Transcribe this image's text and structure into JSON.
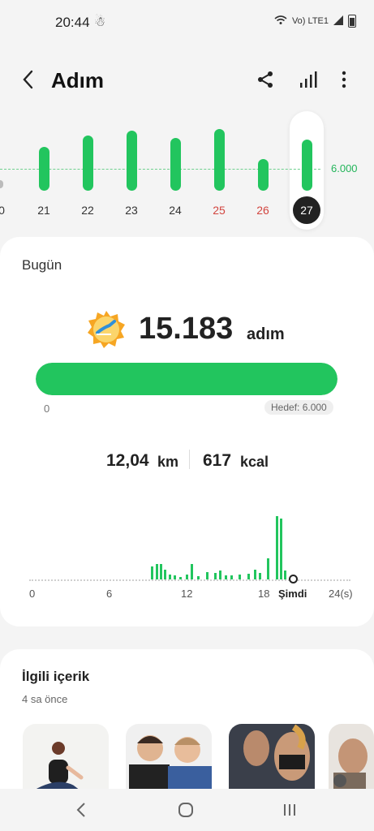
{
  "status_bar": {
    "time": "20:44",
    "network": "Vo) LTE1",
    "icons": [
      "person-icon",
      "wifi-icon",
      "signal-icon",
      "battery-icon"
    ]
  },
  "header": {
    "title": "Adım",
    "actions": [
      "share-icon",
      "stats-icon",
      "more-icon"
    ]
  },
  "week_chart": {
    "goal_label": "6.000",
    "days": [
      {
        "label": "0",
        "value": 0
      },
      {
        "label": "21",
        "value": 0.69
      },
      {
        "label": "22",
        "value": 0.87
      },
      {
        "label": "23",
        "value": 0.95
      },
      {
        "label": "24",
        "value": 0.83
      },
      {
        "label": "25",
        "value": 0.97,
        "weekend": true
      },
      {
        "label": "26",
        "value": 0.5,
        "weekend": true
      },
      {
        "label": "27",
        "value": 0.81,
        "selected": true
      }
    ],
    "colors": {
      "bar": "#22c55e",
      "weekend": "#d2453f"
    }
  },
  "today": {
    "label": "Bugün",
    "steps_value": "15.183",
    "steps_unit": "adım",
    "progress_fraction": 1.0,
    "progress_start": "0",
    "goal": "Hedef: 6.000",
    "distance_value": "12,04",
    "distance_unit": "km",
    "energy_value": "617",
    "energy_unit": "kcal"
  },
  "hourly_chart": {
    "ticks": [
      "0",
      "6",
      "12",
      "18",
      "Şimdi",
      "24(s)"
    ],
    "hours": [
      9.3,
      9.7,
      10.0,
      10.3,
      10.7,
      11.1,
      11.5,
      12.0,
      12.4,
      12.9,
      13.6,
      14.2,
      14.6,
      15.0,
      15.5,
      16.1,
      16.8,
      17.3,
      17.7,
      18.3,
      19.0,
      19.3,
      19.6
    ],
    "values": [
      0.2,
      0.25,
      0.25,
      0.15,
      0.08,
      0.06,
      0.04,
      0.08,
      0.25,
      0.05,
      0.12,
      0.1,
      0.14,
      0.06,
      0.07,
      0.08,
      0.09,
      0.16,
      0.1,
      0.33,
      1.0,
      0.96,
      0.14
    ]
  },
  "related": {
    "title": "İlgili içerik",
    "time": "4 sa önce",
    "thumbnails": [
      "workout-thumbnail-1",
      "workout-thumbnail-2",
      "workout-thumbnail-3",
      "workout-thumbnail-4"
    ]
  },
  "nav": {
    "icons": [
      "back-nav-icon",
      "home-nav-icon",
      "recents-nav-icon"
    ]
  }
}
